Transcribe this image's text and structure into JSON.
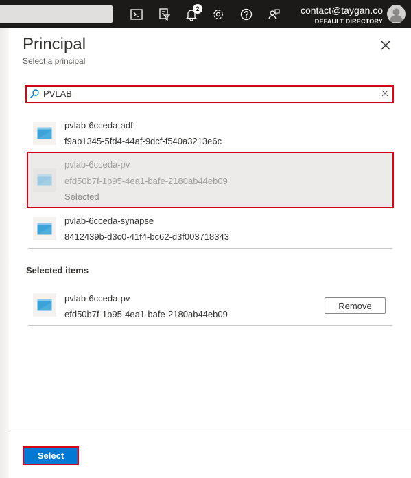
{
  "topbar": {
    "icons": [
      "cloud-shell-icon",
      "directory-filter-icon",
      "notifications-icon",
      "settings-icon",
      "help-icon",
      "feedback-icon"
    ],
    "notification_count": "2",
    "account_email": "contact@taygan.co",
    "account_directory": "DEFAULT DIRECTORY"
  },
  "blade": {
    "title": "Principal",
    "subtitle": "Select a principal"
  },
  "search": {
    "value": "PVLAB"
  },
  "results": [
    {
      "name": "pvlab-6cceda-adf",
      "id": "f9ab1345-5fd4-44af-9dcf-f540a3213e6c",
      "status": ""
    },
    {
      "name": "pvlab-6cceda-pv",
      "id": "efd50b7f-1b95-4ea1-bafe-2180ab44eb09",
      "status": "Selected"
    },
    {
      "name": "pvlab-6cceda-synapse",
      "id": "8412439b-d3c0-41f4-bc62-d3f003718343",
      "status": ""
    }
  ],
  "selected_items": {
    "heading": "Selected items",
    "items": [
      {
        "name": "pvlab-6cceda-pv",
        "id": "efd50b7f-1b95-4ea1-bafe-2180ab44eb09",
        "action": "Remove"
      }
    ]
  },
  "footer": {
    "select_label": "Select"
  },
  "colors": {
    "topbar": "#1b1a19",
    "accent": "#0078d4",
    "highlight": "#d4001c"
  }
}
